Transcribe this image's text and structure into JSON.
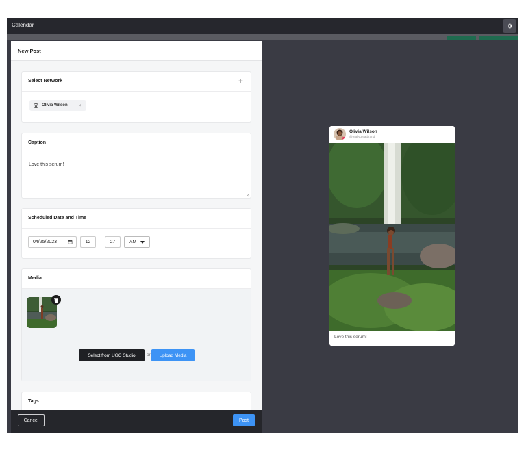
{
  "window": {
    "title": "Calendar"
  },
  "panel": {
    "title": "New Post",
    "network": {
      "label": "Select Network",
      "plus": "+",
      "chip": {
        "name": "Olivia Wilson",
        "remove": "×",
        "icon": "instagram-icon"
      }
    },
    "caption": {
      "label": "Caption",
      "value": "Love this serum!"
    },
    "schedule": {
      "label": "Scheduled Date and Time",
      "date": "04/25/2023",
      "hour": "12",
      "separator": ":",
      "minute": "27",
      "ampm": "AM"
    },
    "media": {
      "label": "Media",
      "select_button": "Select from UGC Studio",
      "or": "or",
      "upload_button": "Upload Media"
    },
    "tags": {
      "label": "Tags"
    },
    "footer": {
      "cancel": "Cancel",
      "post": "Post"
    }
  },
  "preview": {
    "name": "Olivia Wilson",
    "handle": "@reallygreatbrand",
    "caption": "Love this serum!"
  },
  "colors": {
    "topbar": "#26272d",
    "background": "#3a3b44",
    "primary": "#3d93f5",
    "dark_button": "#1f2024",
    "green_tab": "#1f6b4f"
  }
}
